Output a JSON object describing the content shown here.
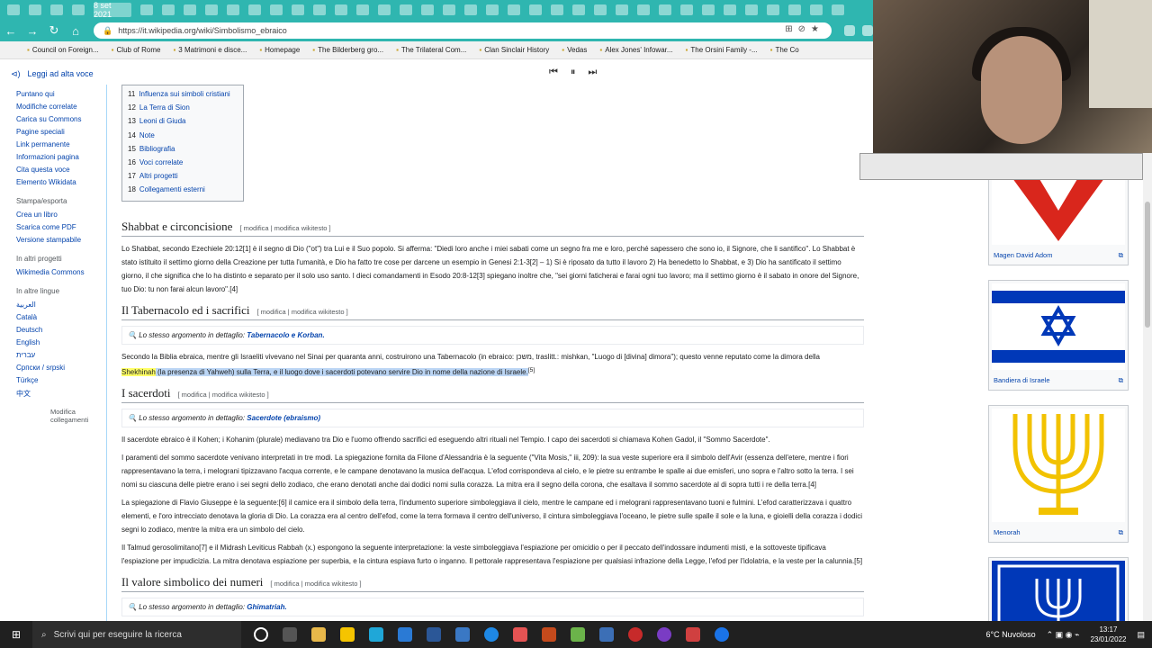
{
  "browser": {
    "active_tab_label": "8 set 2021",
    "url": "https://it.wikipedia.org/wiki/Simbolismo_ebraico",
    "bookmarks": [
      "Council on Foreign...",
      "Club of Rome",
      "3 Matrimoni e disce...",
      "Homepage",
      "The Bilderberg gro...",
      "The Trilateral Com...",
      "Clan Sinclair History",
      "Vedas",
      "Alex Jones' Infowar...",
      "The Orsini Family -...",
      "The Co"
    ]
  },
  "readaloud": {
    "label": "Leggi ad alta voce"
  },
  "sidebar": {
    "tools": [
      "Puntano qui",
      "Modifiche correlate",
      "Carica su Commons",
      "Pagine speciali",
      "Link permanente",
      "Informazioni pagina",
      "Cita questa voce",
      "Elemento Wikidata"
    ],
    "print_heading": "Stampa/esporta",
    "print": [
      "Crea un libro",
      "Scarica come PDF",
      "Versione stampabile"
    ],
    "projects_heading": "In altri progetti",
    "projects": [
      "Wikimedia Commons"
    ],
    "langs_heading": "In altre lingue",
    "langs": [
      "العربية",
      "Català",
      "Deutsch",
      "English",
      "עברית",
      "Српски / srpski",
      "Türkçe",
      "中文"
    ],
    "edit_links": "Modifica collegamenti"
  },
  "toc": [
    {
      "n": "11",
      "t": "Influenza sui simboli cristiani"
    },
    {
      "n": "12",
      "t": "La Terra di Sion"
    },
    {
      "n": "13",
      "t": "Leoni di Giuda"
    },
    {
      "n": "14",
      "t": "Note"
    },
    {
      "n": "15",
      "t": "Bibliografia"
    },
    {
      "n": "16",
      "t": "Voci correlate"
    },
    {
      "n": "17",
      "t": "Altri progetti"
    },
    {
      "n": "18",
      "t": "Collegamenti esterni"
    }
  ],
  "edit_links": "[ modifica | modifica wikitesto ]",
  "section1": {
    "title": "Shabbat e circoncisione",
    "p1": "Lo Shabbat, secondo Ezechiele 20:12[1] è il segno di Dio (\"ot\") tra Lui e il Suo popolo. Si afferma: \"Diedi loro anche i miei sabati come un segno fra me e loro, perché sapessero che sono io, il Signore, che li santifico\". Lo Shabbat è stato istituito il settimo giorno della Creazione per tutta l'umanità, e Dio ha fatto tre cose per darcene un esempio in Genesi 2:1-3[2] – 1) Si è riposato da tutto il lavoro 2) Ha benedetto lo Shabbat, e 3) Dio ha santificato il settimo giorno, il che significa che lo ha distinto e separato per il solo uso santo. I dieci comandamenti in Esodo 20:8-12[3] spiegano inoltre che, \"sei giorni faticherai e farai ogni tuo lavoro; ma il settimo giorno è il sabato in onore del Signore, tuo Dio: tu non farai alcun lavoro\".[4]"
  },
  "section2": {
    "title": "Il Tabernacolo ed i sacrifici",
    "hatnote_prefix": "Lo stesso argomento in dettaglio:",
    "hatnote_link": "Tabernacolo e Korban.",
    "p1_start": "Secondo la Biblia ebraica, mentre gli Israeliti vivevano nel Sinai per quaranta anni, costruirono una Tabernacolo (in ebraico: משכן‎, traslitt.: mishkan, \"Luogo di [divina] dimora\"); questo venne reputato come la dimora della",
    "p1_hl": "Shekhinah",
    "p1_sel": " (la presenza di Yahweh) sulla Terra, e il luogo dove i sacerdoti potevano servire Dio in nome della nazione di Israele.",
    "p1_ref": "[5]"
  },
  "section3": {
    "title": "I sacerdoti",
    "hatnote_prefix": "Lo stesso argomento in dettaglio:",
    "hatnote_link": "Sacerdote (ebraismo)",
    "p1": "Il sacerdote ebraico è il Kohen; i Kohanim (plurale) mediavano tra Dio e l'uomo offrendo sacrifici ed eseguendo altri rituali nel Tempio. I capo dei sacerdoti si chiamava Kohen Gadol, il \"Sommo Sacerdote\".",
    "p2": "I paramenti del sommo sacerdote venivano interpretati in tre modi. La spiegazione fornita da Filone d'Alessandria è la seguente (\"Vita Mosis,\" iii, 209): la sua veste superiore era il simbolo dell'Avir (essenza dell'etere, mentre i fiori rappresentavano la terra, i melograni tipizzavano l'acqua corrente, e le campane denotavano la musica dell'acqua. L'efod corrispondeva al cielo, e le pietre su entrambe le spalle ai due emisferi, uno sopra e l'altro sotto la terra. I sei nomi su ciascuna delle pietre erano i sei segni dello zodiaco, che erano denotati anche dai dodici nomi sulla corazza. La mitra era il segno della corona, che esaltava il sommo sacerdote al di sopra tutti i re della terra.[4]",
    "p3": "La spiegazione di Flavio Giuseppe è la seguente:[6] il camice era il simbolo della terra, l'indumento superiore simboleggiava il cielo, mentre le campane ed i melograni rappresentavano tuoni e fulmini. L'efod caratterizzava i quattro elementi, e l'oro intrecciato denotava la gloria di Dio. La corazza era al centro dell'efod, come la terra formava il centro dell'universo, il cintura simboleggiava l'oceano, le pietre sulle spalle il sole e la luna, e gioielli della corazza i dodici segni lo zodiaco, mentre la mitra era un simbolo del cielo.",
    "p4": "Il Talmud gerosolimitano[7] e il Midrash Leviticus Rabbah (x.) espongono la seguente interpretazione: la veste simboleggiava l'espiazione per omicidio o per il peccato dell'indossare indumenti misti, e la sottoveste tipificava l'espiazione per impudicizia. La mitra denotava espiazione per superbia, e la cintura espiava furto o inganno. Il pettorale rappresentava l'espiazione per qualsiasi infrazione della Legge, l'efod per l'idolatria, e la veste per la calunnia.[5]"
  },
  "section4": {
    "title": "Il valore simbolico dei numeri",
    "hatnote_prefix": "Lo stesso argomento in dettaglio:",
    "hatnote_link": "Ghimatriah."
  },
  "images": [
    {
      "caption": "Magen David Adom"
    },
    {
      "caption": "Bandiera di Israele"
    },
    {
      "caption": "Menorah"
    }
  ],
  "taskbar": {
    "search_placeholder": "Scrivi qui per eseguire la ricerca",
    "weather": "6°C  Nuvoloso",
    "time": "13:17",
    "date": "23/01/2022"
  },
  "colors": {
    "accent": "#2fb6b0",
    "link": "#0645ad",
    "flag_blue": "#0038b8",
    "star_red": "#d9261c",
    "menorah_gold": "#f2c200"
  }
}
